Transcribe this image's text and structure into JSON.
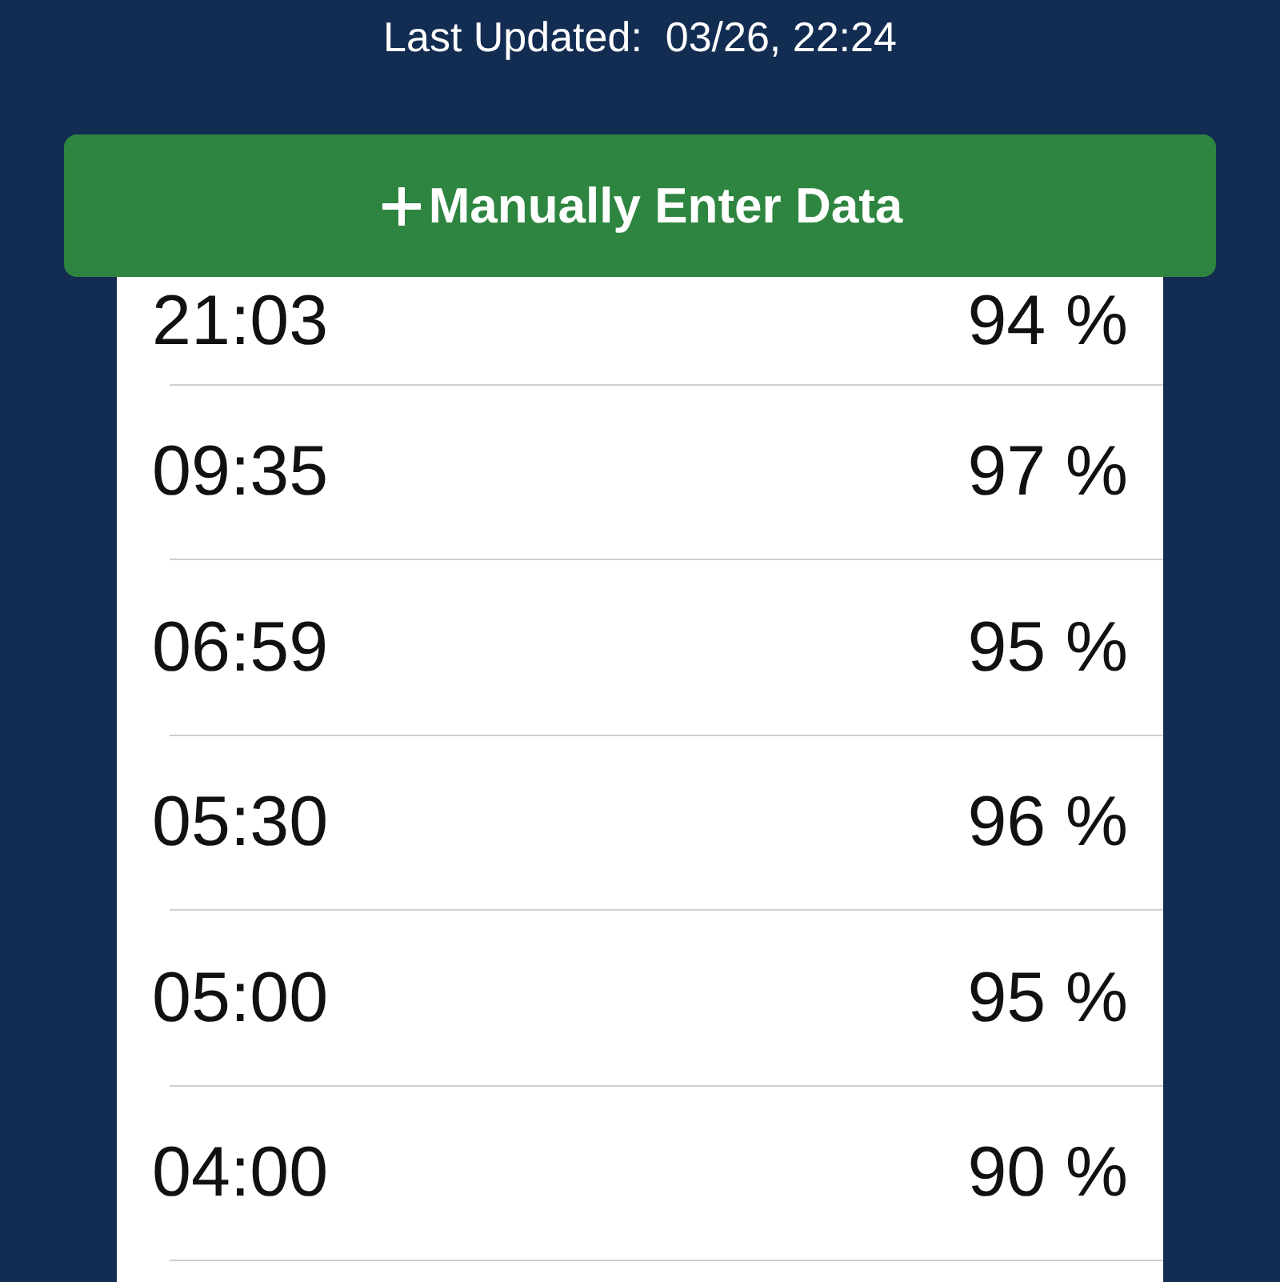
{
  "last_updated": {
    "label": "Last Updated:",
    "value": "03/26, 22:24"
  },
  "add_button": {
    "label": "Manually Enter Data"
  },
  "readings": [
    {
      "time": "21:03",
      "value": "94 %"
    },
    {
      "time": "09:35",
      "value": "97 %"
    },
    {
      "time": "06:59",
      "value": "95 %"
    },
    {
      "time": "05:30",
      "value": "96 %"
    },
    {
      "time": "05:00",
      "value": "95 %"
    },
    {
      "time": "04:00",
      "value": "90 %"
    }
  ]
}
